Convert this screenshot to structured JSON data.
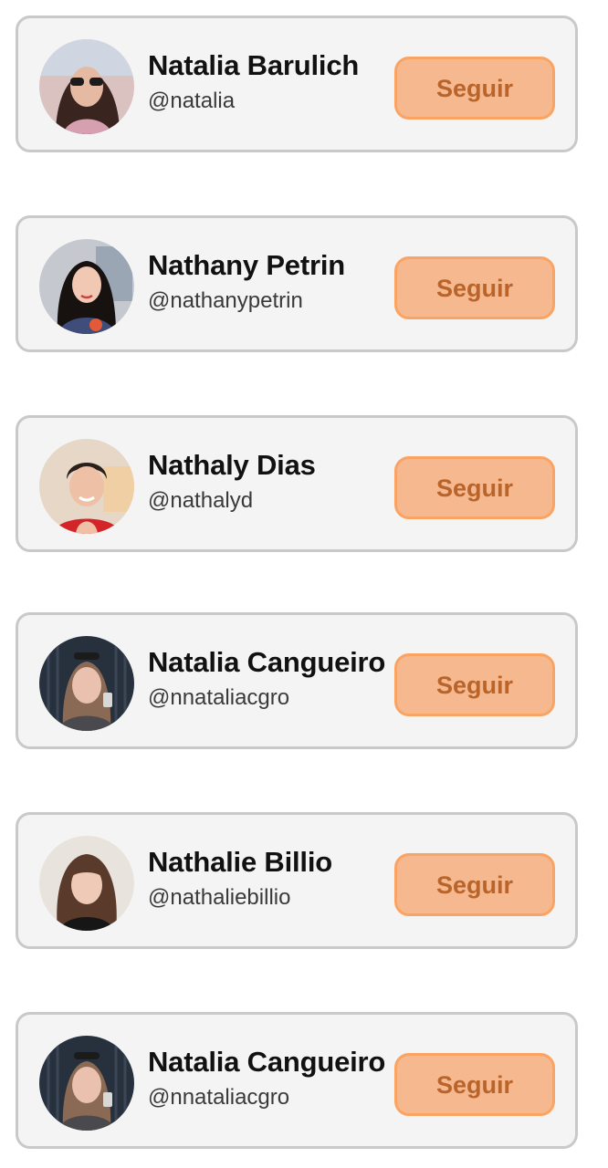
{
  "accent_colors": {
    "button_fill": "#f5b88f",
    "button_border": "#fba362",
    "button_text": "#b8642a",
    "card_background": "#f4f4f4",
    "card_border": "#c9c9c9"
  },
  "suggestions": [
    {
      "name": "Natalia Barulich",
      "handle": "@natalia",
      "button_label": "Seguir",
      "avatar": "profile-photo"
    },
    {
      "name": "Nathany Petrin",
      "handle": "@nathanypetrin",
      "button_label": "Seguir",
      "avatar": "profile-photo"
    },
    {
      "name": "Nathaly Dias",
      "handle": "@nathalyd",
      "button_label": "Seguir",
      "avatar": "profile-photo"
    },
    {
      "name": "Natalia Cangueiro",
      "handle": "@nnataliacgro",
      "button_label": "Seguir",
      "avatar": "profile-photo"
    },
    {
      "name": "Nathalie Billio",
      "handle": "@nathaliebillio",
      "button_label": "Seguir",
      "avatar": "profile-photo"
    },
    {
      "name": "Natalia Cangueiro",
      "handle": "@nnataliacgro",
      "button_label": "Seguir",
      "avatar": "profile-photo"
    }
  ]
}
